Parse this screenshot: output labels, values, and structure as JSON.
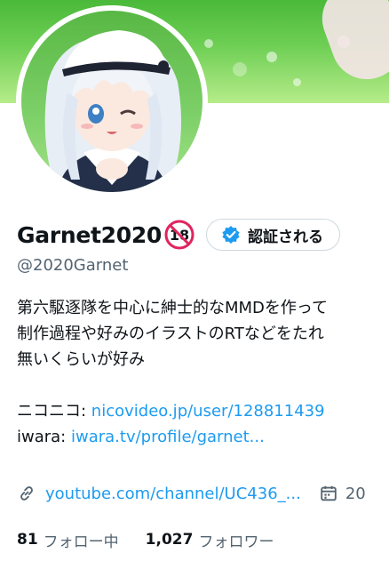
{
  "profile": {
    "display_name": "Garnet2020",
    "age_badge": "18",
    "verify_button_label": "認証される",
    "handle": "@2020Garnet"
  },
  "bio": {
    "line1": "第六駆逐隊を中心に紳士的なMMDを作って",
    "line2": "制作過程や好みのイラストのRTなどをたれ",
    "line3": "無いくらいが好み",
    "nico_label": "ニコニコ: ",
    "nico_link": "nicovideo.jp/user/128811439",
    "iwara_label": "iwara: ",
    "iwara_link": "iwara.tv/profile/garnet..."
  },
  "meta": {
    "website": "youtube.com/channel/UC436_...",
    "joined": "20"
  },
  "stats": {
    "following_count": "81",
    "following_label": "フォロー中",
    "followers_count": "1,027",
    "followers_label": "フォロワー"
  },
  "icons": {
    "age": "no-18-icon",
    "verify": "verified-badge-icon",
    "link": "link-icon",
    "calendar": "calendar-icon"
  },
  "colors": {
    "link": "#1d9bf0",
    "secondary_text": "#536471",
    "primary_text": "#0f1419",
    "verify_blue": "#1d9bf0",
    "age_red": "#e0245e"
  }
}
